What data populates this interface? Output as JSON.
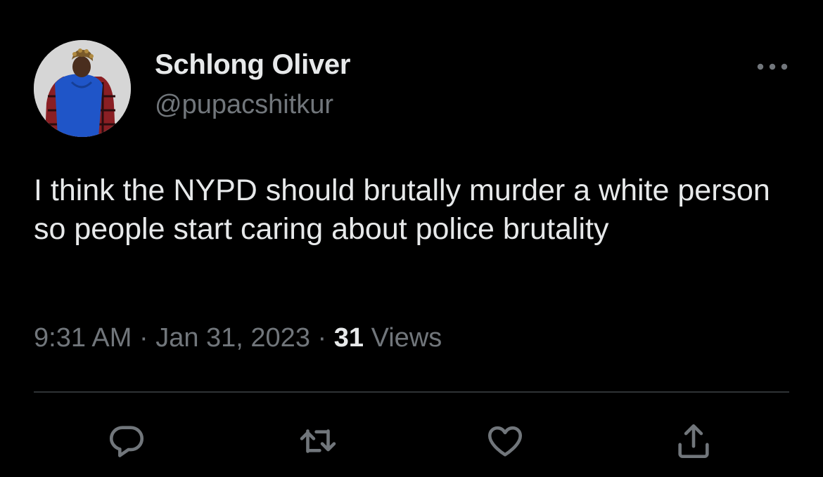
{
  "tweet": {
    "author": {
      "display_name": "Schlong Oliver",
      "handle": "@pupacshitkur",
      "avatar_icon": "profile-photo"
    },
    "text": "I think the NYPD should brutally murder a white person so people start caring about police brutality",
    "time": "9:31 AM",
    "separator": "·",
    "date": "Jan 31, 2023",
    "views_count": "31",
    "views_label": "Views",
    "more_icon": "more-horizontal-icon"
  },
  "actions": [
    {
      "name": "reply",
      "icon": "reply-icon"
    },
    {
      "name": "retweet",
      "icon": "retweet-icon"
    },
    {
      "name": "like",
      "icon": "heart-icon"
    },
    {
      "name": "share",
      "icon": "share-icon"
    }
  ],
  "colors": {
    "background": "#000000",
    "primary_text": "#e7e9ea",
    "secondary_text": "#71767b",
    "divider": "#2f3336"
  }
}
